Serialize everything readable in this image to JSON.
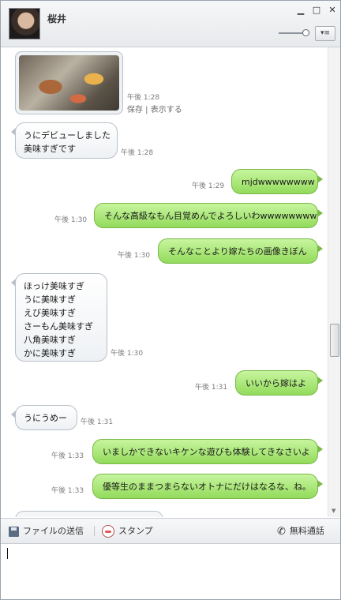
{
  "header": {
    "contact_name": "桜井",
    "minimize": "▁",
    "maximize": "□",
    "close": "✕",
    "menu": "▾≡"
  },
  "photo_message": {
    "time": "午後 1:28",
    "actions": "保存 | 表示する"
  },
  "messages": [
    {
      "dir": "in",
      "text": "うにデビューしました\n美味すぎです",
      "time": "午後 1:28"
    },
    {
      "dir": "out",
      "text": "mjdwwwwwwww",
      "time": "午後 1:29"
    },
    {
      "dir": "out",
      "text": "そんな高級なもん目覚めんでよろしいわwwwwwwww",
      "time": "午後 1:30"
    },
    {
      "dir": "out",
      "text": "そんなことより嫁たちの画像きぼん",
      "time": "午後 1:30"
    },
    {
      "dir": "in",
      "text": "ほっけ美味すぎ\nうに美味すぎ\nえび美味すぎ\nさーもん美味すぎ\n八角美味すぎ\nかに美味すぎ",
      "time": "午後 1:30"
    },
    {
      "dir": "out",
      "text": "いいから嫁はよ",
      "time": "午後 1:31"
    },
    {
      "dir": "in",
      "text": "うにうめー",
      "time": "午後 1:31"
    },
    {
      "dir": "out",
      "text": "いましかできないキケンな遊びも体験してきなさいよ",
      "time": "午後 1:33"
    },
    {
      "dir": "out",
      "text": "優等生のままつまらないオトナにだけはなるな、ね。",
      "time": "午後 1:33"
    }
  ],
  "toolbar": {
    "file_send": "ファイルの送信",
    "stamp": "スタンプ",
    "free_call": "無料通話"
  },
  "colors": {
    "outgoing_bubble": "#a6e774",
    "incoming_bubble": "#f2f4f6"
  },
  "scrollbar": {
    "position_fraction": 0.65
  }
}
